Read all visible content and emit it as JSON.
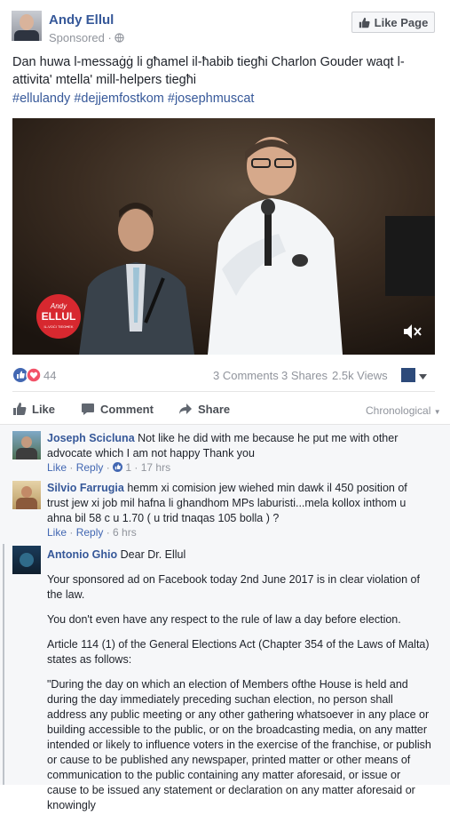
{
  "post": {
    "page_name": "Andy Ellul",
    "sponsored": "Sponsored · ",
    "like_page_label": "Like Page",
    "text": "Dan huwa l-messaġġ li għamel il-ħabib tiegħi Charlon Gouder waqt l-attivita' mtella' mill-helpers tiegħi",
    "hashtags": "#ellulandy #dejjemfostkom #josephmuscat",
    "video_logo_line1": "Andy",
    "video_logo_line2": "ELLUL",
    "video_logo_line3": "IL-VOĊI TIEGĦEK",
    "reactions_count": "44",
    "comments_count": "3 Comments",
    "shares_count": "3 Shares",
    "views_count": "2.5k Views"
  },
  "actions": {
    "like": "Like",
    "comment": "Comment",
    "share": "Share",
    "sort": "Chronological"
  },
  "comments": [
    {
      "name": "Joseph Scicluna",
      "text": "Not like he did with me because he put me with other advocate which I am not happy Thank you",
      "like": "Like",
      "reply": "Reply",
      "likes": "1",
      "time": "17 hrs"
    },
    {
      "name": "Silvio Farrugia",
      "text": "hemm xi comision jew wiehed min dawk il 450 position of trust jew xi job mil hafna li ghandhom MPs laburisti...mela kollox inthom u ahna bil 58 c u 1.70 ( u trid tnaqas 105 bolla ) ?",
      "like": "Like",
      "reply": "Reply",
      "time": "6 hrs"
    },
    {
      "name": "Antonio Ghio",
      "first_line": "Dear Dr. Ellul",
      "paragraphs": [
        "Your sponsored ad on Facebook today 2nd June 2017 is in clear violation of the law.",
        "You don't even have any respect to the rule of law a day before election.",
        "Article 114 (1) of the General Elections Act (Chapter 354 of the Laws of Malta) states as follows:",
        "\"During the day on which an election of Members ofthe House is held and during the day immediately preceding suchan election, no person shall address any public meeting or any other gathering whatsoever in any place or building accessible to the public, or on the broadcasting media, on any matter intended or likely to influence voters in the exercise of the franchise, or publish or cause to be published any newspaper, printed matter or other means of communication to the public containing any matter aforesaid, or issue or cause to be issued any statement or declaration on any matter aforesaid or knowingly"
      ]
    }
  ],
  "colors": {
    "link": "#365899",
    "meta": "#90949c",
    "like_blue": "#4267b2",
    "love_red": "#f25268",
    "logo_red": "#d7282f"
  },
  "icons": [
    "globe-icon",
    "thumb-up-icon",
    "heart-icon",
    "comment-icon",
    "share-arrow-icon",
    "mute-icon",
    "caret-down-icon"
  ]
}
